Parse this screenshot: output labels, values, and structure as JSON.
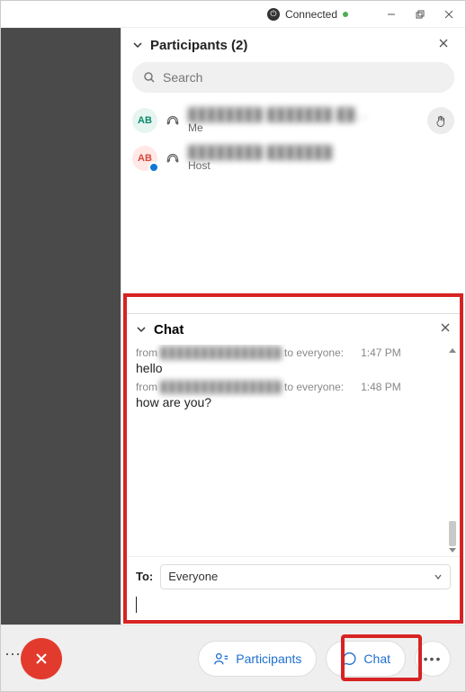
{
  "titlebar": {
    "status_label": "Connected"
  },
  "participants": {
    "header": "Participants (2)",
    "search_placeholder": "Search",
    "items": [
      {
        "initials": "AB",
        "name_masked": "████████ ███████ ██…",
        "sub": "Me",
        "raised_hand": true
      },
      {
        "initials": "AB",
        "name_masked": "████████ ███████",
        "sub": "Host",
        "raised_hand": false
      }
    ]
  },
  "chat": {
    "header": "Chat",
    "messages": [
      {
        "from_label": "from",
        "sender_masked": "███████████████",
        "to_label": "to everyone:",
        "time": "1:47 PM",
        "text": "hello"
      },
      {
        "from_label": "from",
        "sender_masked": "███████████████",
        "to_label": "to everyone:",
        "time": "1:48 PM",
        "text": "how are you?"
      }
    ],
    "to_label": "To:",
    "to_value": "Everyone",
    "input_value": ""
  },
  "bottom": {
    "participants_label": "Participants",
    "chat_label": "Chat"
  }
}
